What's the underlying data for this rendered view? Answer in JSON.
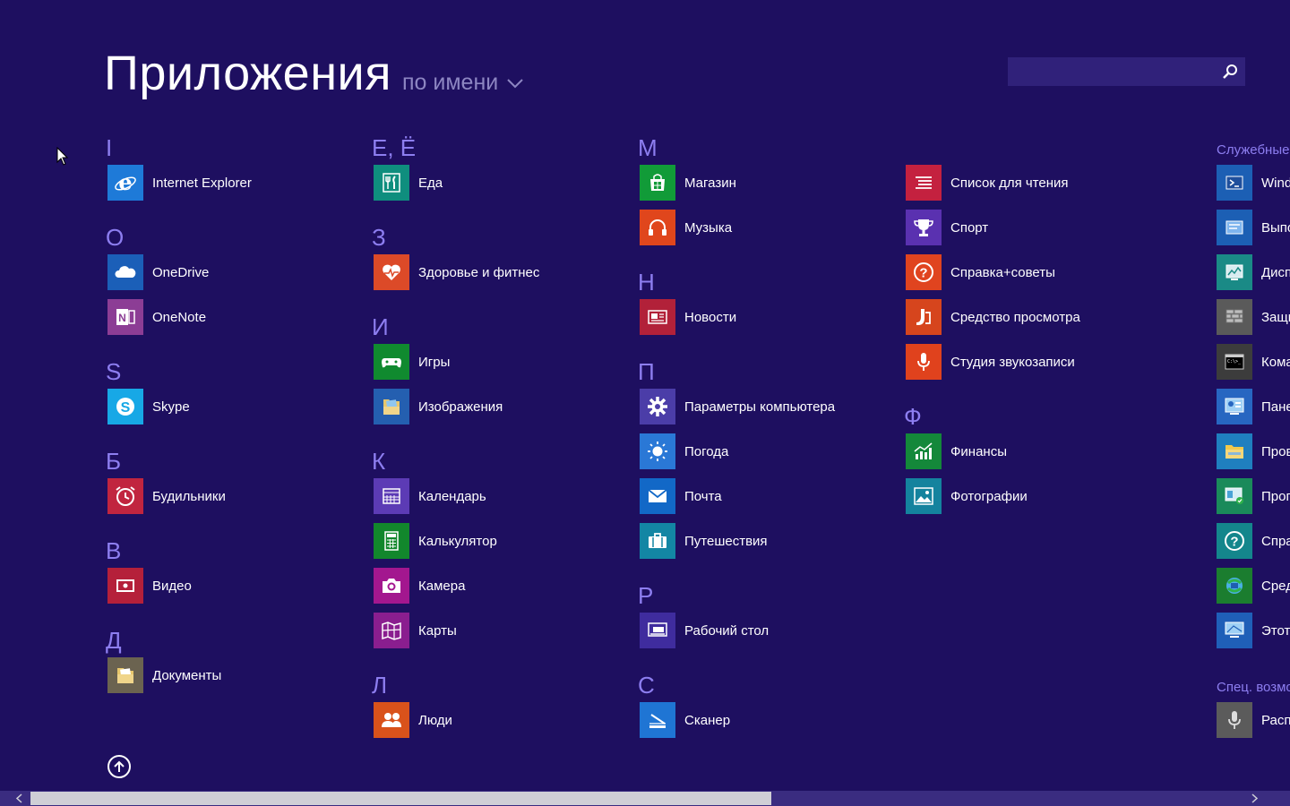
{
  "header": {
    "title": "Приложения",
    "sort_label": "по имени"
  },
  "search": {
    "placeholder": ""
  },
  "groups": {
    "I": "I",
    "O": "O",
    "S": "S",
    "B": "Б",
    "V": "В",
    "D": "Д",
    "E": "Е, Ё",
    "Z": "З",
    "I2": "И",
    "K": "К",
    "L": "Л",
    "M": "М",
    "N": "Н",
    "P": "П",
    "R": "Р",
    "S2": "С",
    "F": "Ф"
  },
  "apps": {
    "ie": "Internet Explorer",
    "onedrive": "OneDrive",
    "onenote": "OneNote",
    "skype": "Skype",
    "alarms": "Будильники",
    "video": "Видео",
    "documents": "Документы",
    "food": "Еда",
    "health": "Здоровье и фитнес",
    "games": "Игры",
    "pictures": "Изображения",
    "calendar": "Календарь",
    "calculator": "Калькулятор",
    "camera": "Камера",
    "maps": "Карты",
    "people": "Люди",
    "store": "Магазин",
    "music": "Музыка",
    "news": "Новости",
    "pcsettings": "Параметры компьютера",
    "weather": "Погода",
    "mail": "Почта",
    "travel": "Путешествия",
    "desktop": "Рабочий стол",
    "scanner": "Сканер",
    "readinglist": "Список для чтения",
    "sport": "Спорт",
    "helptips": "Справка+советы",
    "viewer": "Средство просмотра",
    "soundrec": "Студия звукозаписи",
    "finance": "Финансы",
    "photos": "Фотографии"
  },
  "system": {
    "heading": "Служебные",
    "items": [
      "Wind",
      "Выпо",
      "Дисп",
      "Защи",
      "Кома",
      "Пане",
      "Пров",
      "Прог",
      "Спра",
      "Сред",
      "Этот"
    ],
    "access_heading": "Спец. возмо",
    "access_items": [
      "Расп"
    ]
  },
  "colors": {
    "background": "#1e0f60",
    "letter": "#8d7ef0"
  }
}
